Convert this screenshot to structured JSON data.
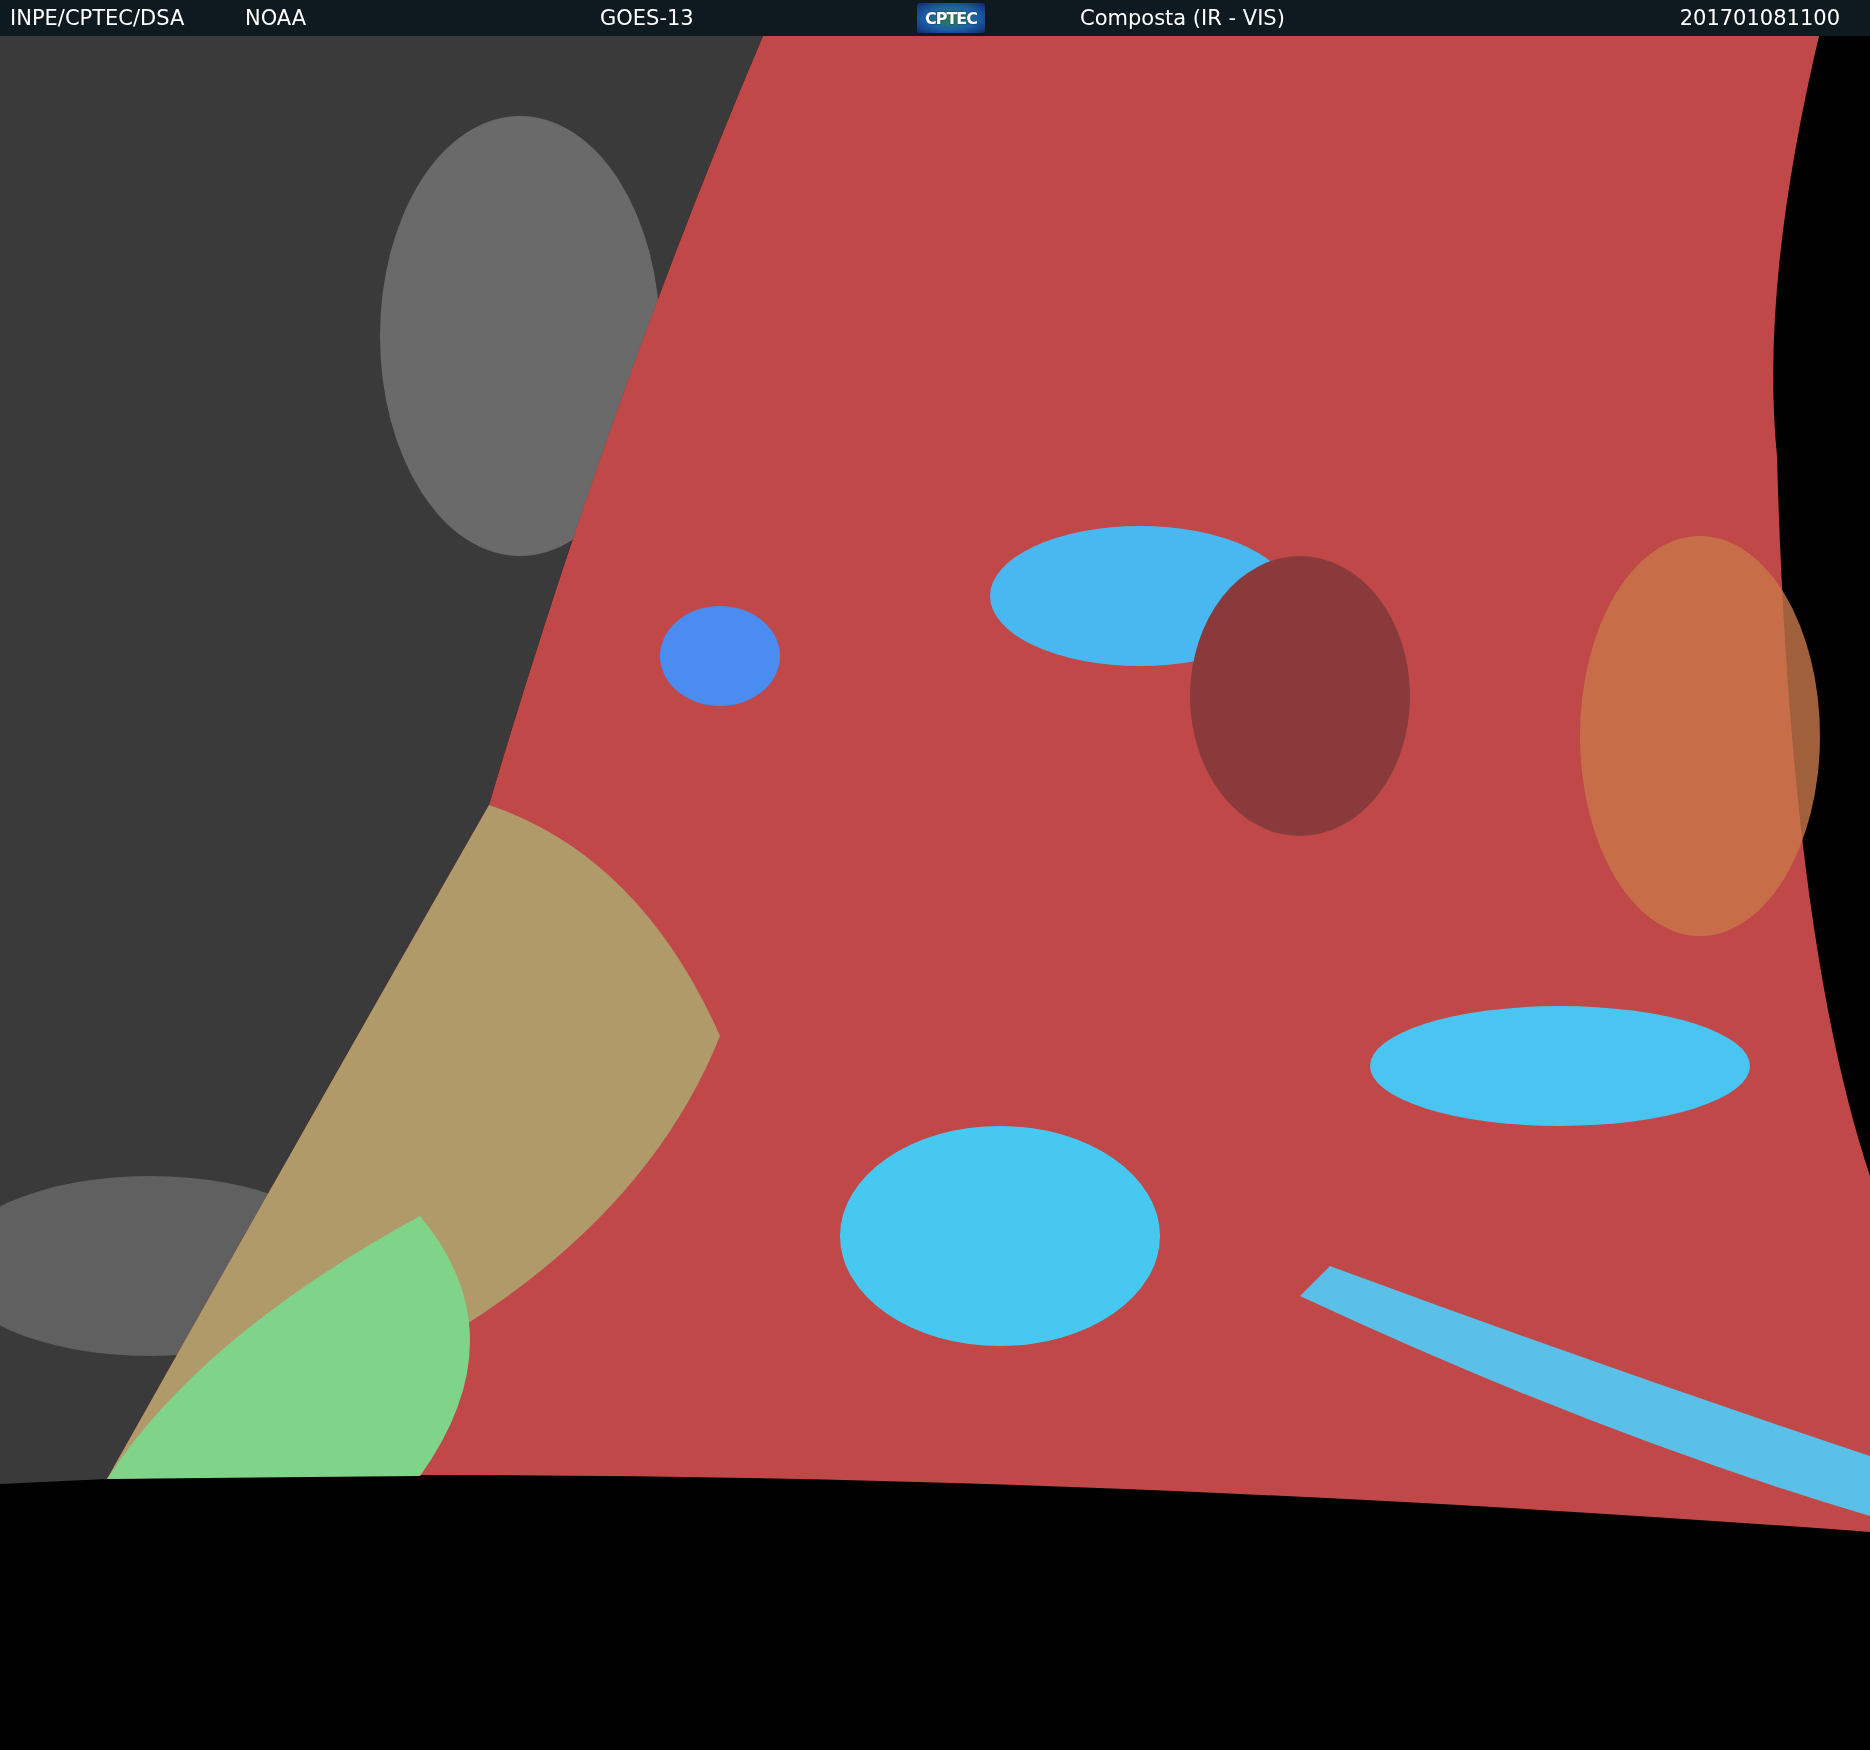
{
  "header": {
    "agency": "INPE/CPTEC/DSA",
    "partner": "NOAA",
    "satellite": "GOES-13",
    "logo": "CPTEC",
    "product": "Composta (IR - VIS)",
    "timestamp": "201701081100"
  }
}
